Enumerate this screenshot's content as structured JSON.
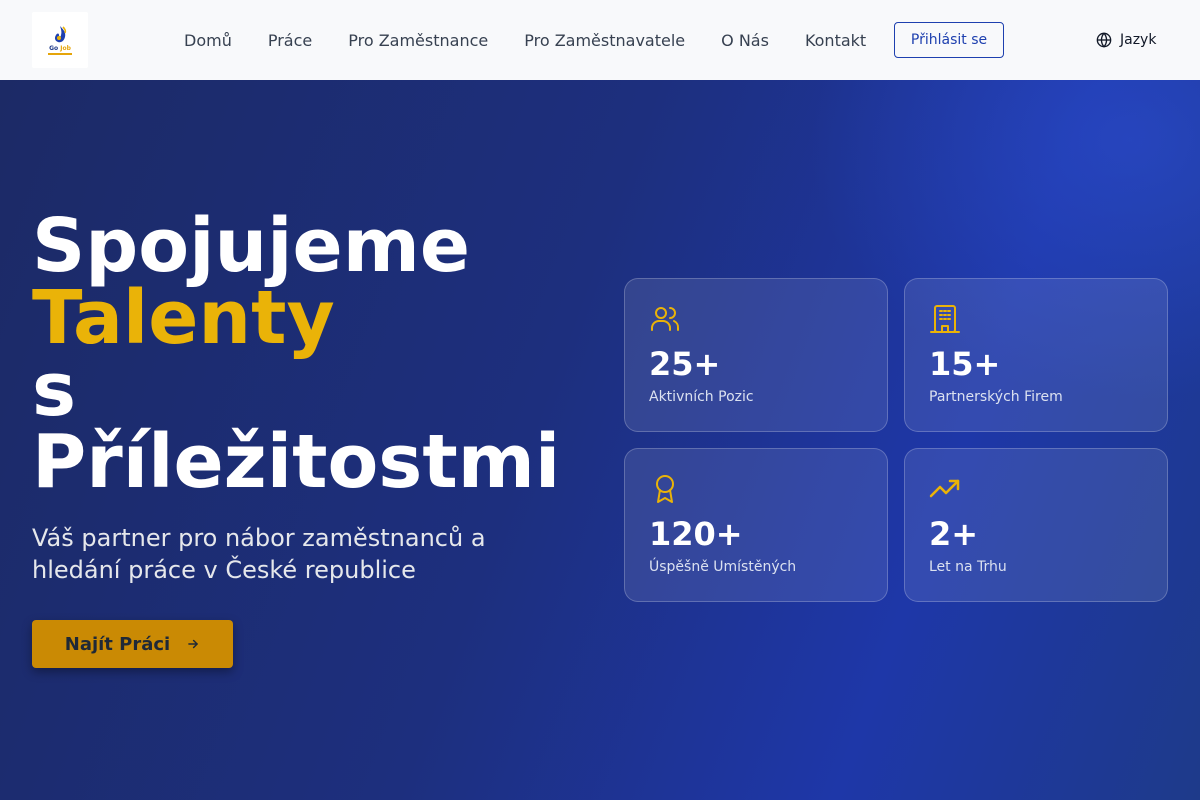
{
  "header": {
    "logo_text_go": "Go",
    "logo_text_job": "Job",
    "nav": [
      "Domů",
      "Práce",
      "Pro Zaměstnance",
      "Pro Zaměstnavatele",
      "O Nás",
      "Kontakt"
    ],
    "login_label": "Přihlásit se",
    "language_label": "Jazyk"
  },
  "hero": {
    "headline_line1": "Spojujeme",
    "headline_line2": "Talenty",
    "headline_line3": "s",
    "headline_line4": "Příležitostmi",
    "subtitle": "Váš partner pro nábor zaměstnanců a hledání práce v České republice",
    "cta_label": "Najít Práci"
  },
  "stats": [
    {
      "icon": "users-icon",
      "value": "25+",
      "label": "Aktivních Pozic"
    },
    {
      "icon": "building-icon",
      "value": "15+",
      "label": "Partnerských Firem"
    },
    {
      "icon": "award-icon",
      "value": "120+",
      "label": "Úspěšně Umístěných"
    },
    {
      "icon": "trending-up-icon",
      "value": "2+",
      "label": "Let na Trhu"
    }
  ],
  "colors": {
    "accent_gold": "#eab308",
    "cta_gold": "#ca8a04",
    "primary_blue": "#1e40af",
    "hero_bg": "#1d2f7e"
  }
}
